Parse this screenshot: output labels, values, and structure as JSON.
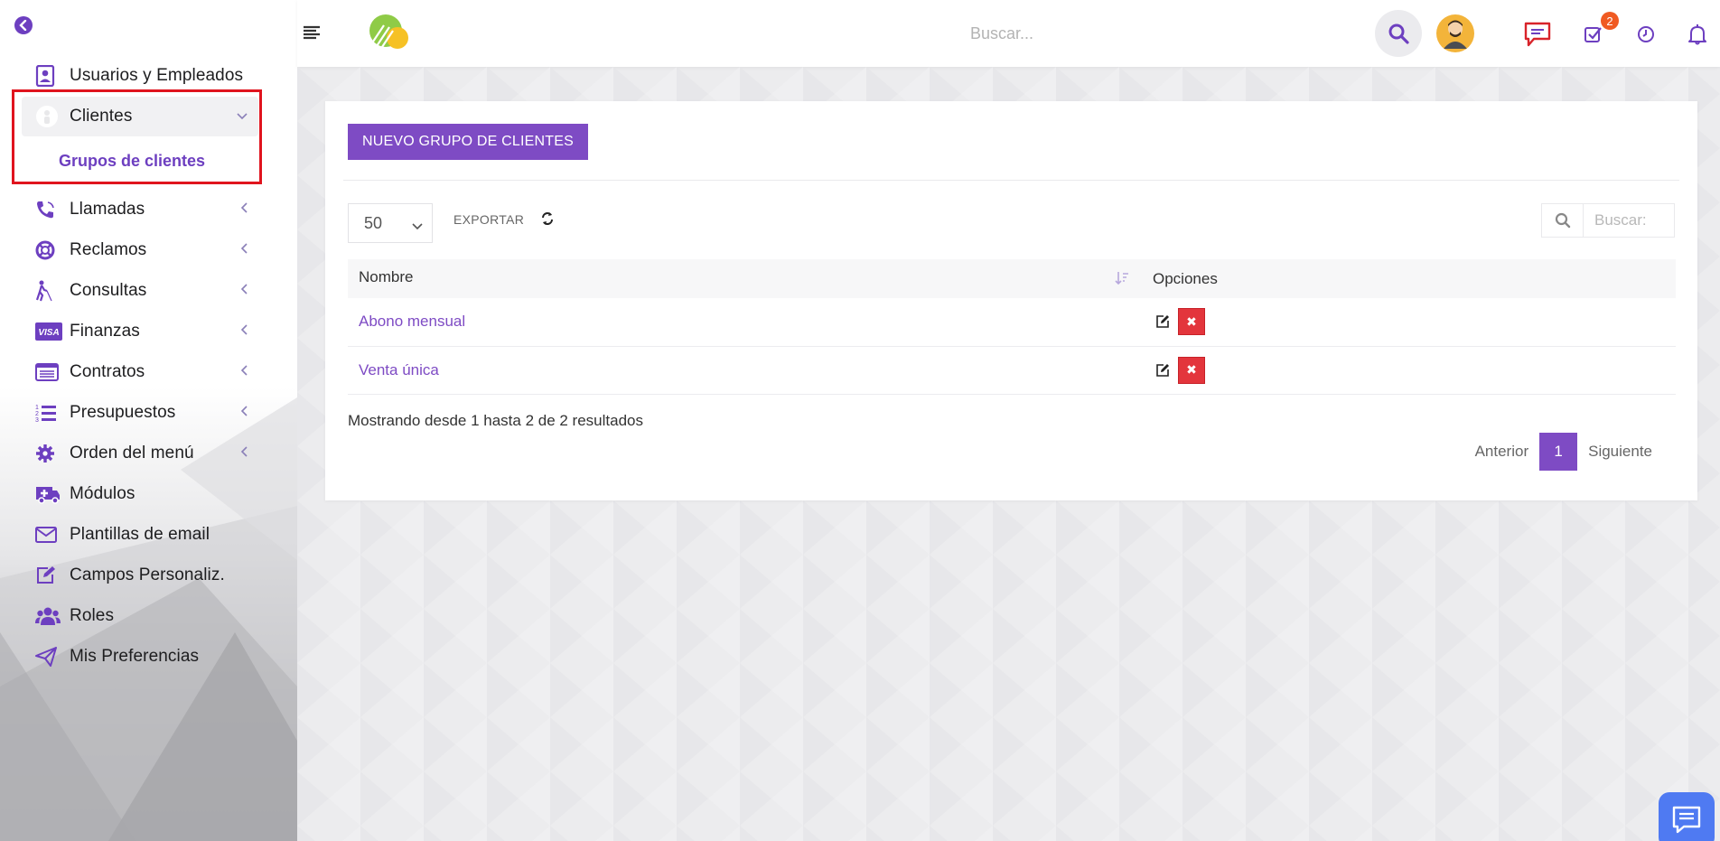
{
  "topbar": {
    "search_placeholder": "Buscar...",
    "notifications_count": "2"
  },
  "sidebar": {
    "items": [
      {
        "label": "Usuarios y Empleados",
        "icon": "user-badge-icon"
      },
      {
        "label": "Clientes",
        "icon": "client-icon",
        "active": true
      },
      {
        "label": "Llamadas",
        "icon": "phone-icon"
      },
      {
        "label": "Reclamos",
        "icon": "lifebuoy-icon"
      },
      {
        "label": "Consultas",
        "icon": "blind-person-icon"
      },
      {
        "label": "Finanzas",
        "icon": "visa-card-icon"
      },
      {
        "label": "Contratos",
        "icon": "contract-list-icon"
      },
      {
        "label": "Presupuestos",
        "icon": "ordered-list-icon"
      },
      {
        "label": "Orden del menú",
        "icon": "gear-icon"
      },
      {
        "label": "Módulos",
        "icon": "ambulance-icon"
      },
      {
        "label": "Plantillas de email",
        "icon": "envelope-icon"
      },
      {
        "label": "Campos Personaliz.",
        "icon": "edit-icon"
      },
      {
        "label": "Roles",
        "icon": "users-icon"
      },
      {
        "label": "Mis Preferencias",
        "icon": "paper-plane-icon"
      }
    ],
    "subitem": "Grupos de clientes"
  },
  "panel": {
    "new_button": "NUEVO GRUPO DE CLIENTES",
    "page_length": "50",
    "export_label": "EXPORTAR",
    "search_placeholder": "Buscar:",
    "columns": [
      "Nombre",
      "Opciones"
    ],
    "rows": [
      {
        "name": "Abono mensual"
      },
      {
        "name": "Venta única"
      }
    ],
    "info": "Mostrando desde 1 hasta 2 de 2 resultados",
    "pagination": {
      "prev": "Anterior",
      "current": "1",
      "next": "Siguiente"
    }
  },
  "colors": {
    "accent": "#7e4bc4",
    "danger": "#e3353c",
    "highlight": "#e0141e"
  }
}
